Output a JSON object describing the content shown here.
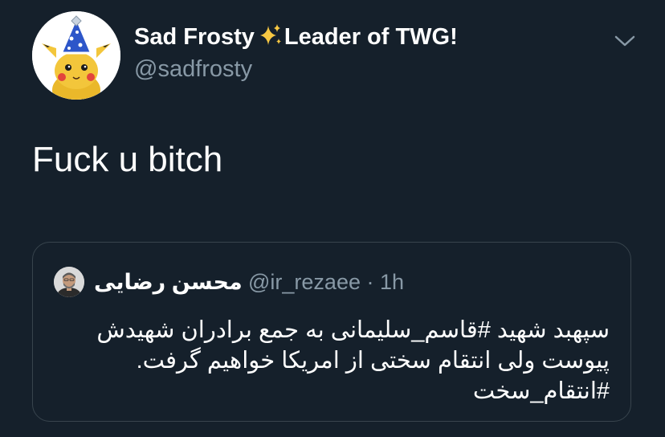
{
  "author": {
    "display_name_part1": "Sad Frosty",
    "display_name_part2": "Leader of TWG!",
    "handle": "@sadfrosty"
  },
  "icons": {
    "avatar": "pikachu-party-hat-avatar",
    "sparkles": "sparkles-emoji",
    "menu": "chevron-down-icon"
  },
  "tweet": {
    "text": "Fuck u bitch"
  },
  "quoted_tweet": {
    "author_name": "محسن رضایی",
    "handle": "@ir_rezaee",
    "separator": " · ",
    "time": "1h",
    "text_lines": [
      "سپهبد شهید #قاسم_سلیمانی به جمع برادران شهیدش",
      "پیوست ولی انتقام سختی از امریکا خواهیم گرفت.",
      "#انتقام_سخت"
    ]
  },
  "colors": {
    "background": "#15202b",
    "primary_text": "#ffffff",
    "secondary_text": "#8899a6",
    "border": "#38444d"
  }
}
